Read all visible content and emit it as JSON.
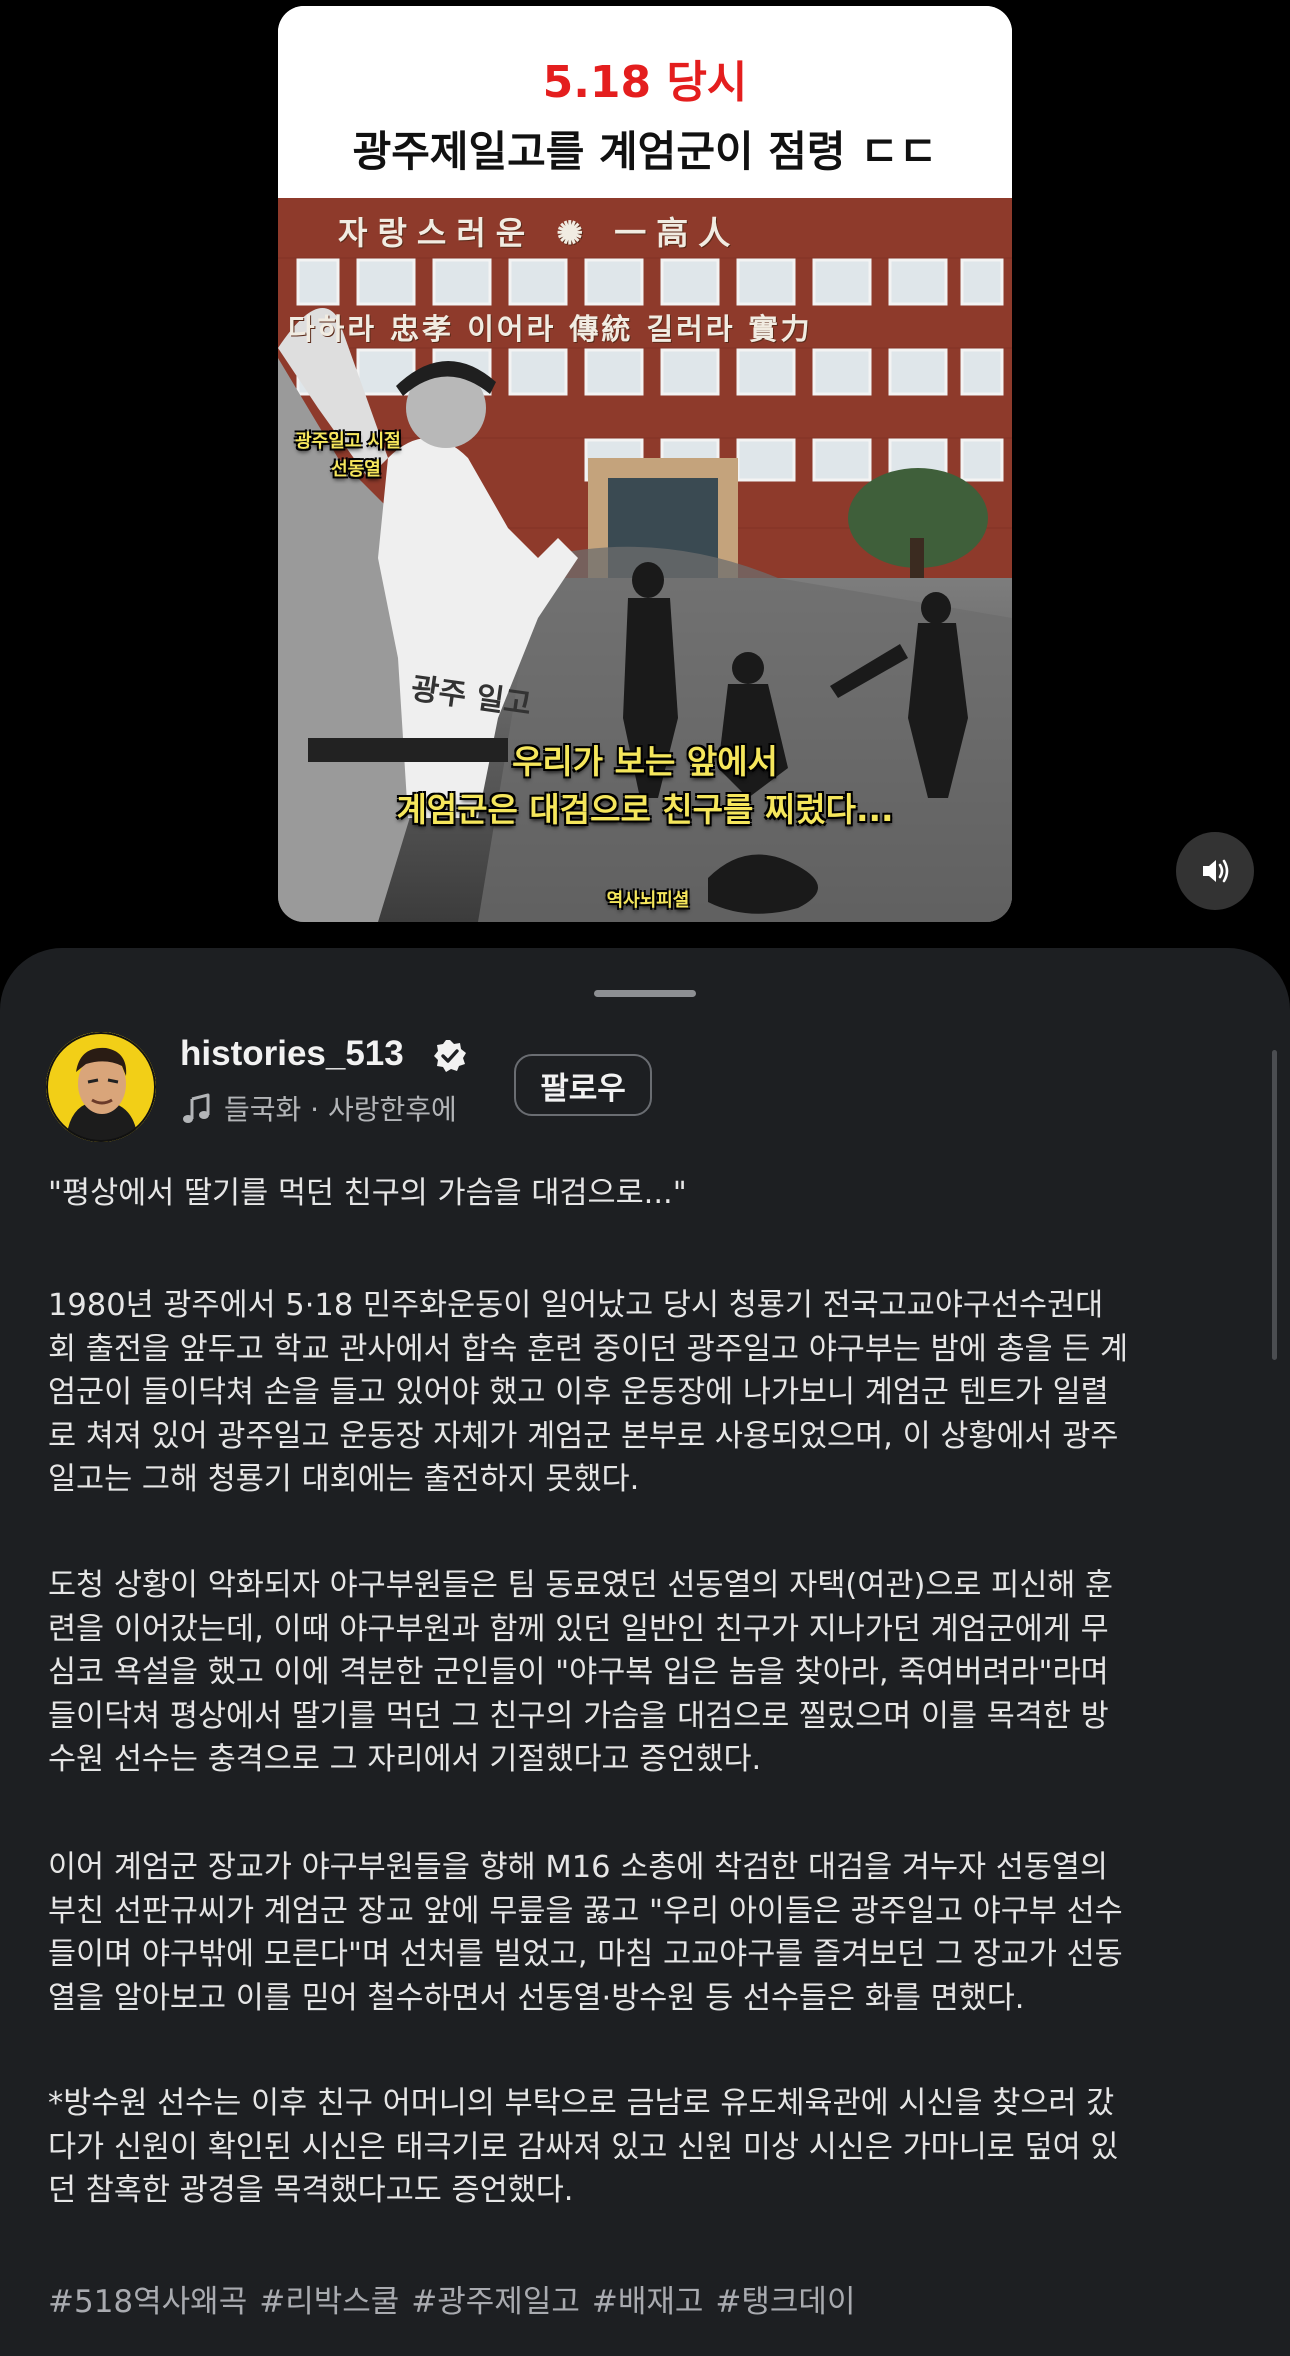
{
  "video": {
    "title_line1": "5.18 당시",
    "title_line2": "광주제일고를 계엄군이 점령 ㄷㄷ",
    "sign_top": "자랑스러운 ✺ 一高人",
    "sign_middle": "다하라 忠孝  이어라 傳統  길러라 實力",
    "photo_label_line1": "광주일고 시절",
    "photo_label_line2": "선동열",
    "caption_line1": "우리가 보는 앞에서",
    "caption_line2": "계엄군은 대검으로 친구를 찌렀다...",
    "watermark": "역사뇌피셜",
    "sound_icon": "speaker-icon"
  },
  "profile": {
    "username": "histories_513",
    "verified_icon": "verified-badge-icon",
    "music_icon": "music-note-icon",
    "music": "들국화 · 사랑한후에",
    "follow_label": "팔로우"
  },
  "description": {
    "quote": "\"평상에서 딸기를 먹던 친구의 가슴을 대검으로...\"",
    "paragraph1": "1980년 광주에서 5·18 민주화운동이 일어났고 당시 청룡기 전국고교야구선수권대\n회 출전을 앞두고 학교 관사에서 합숙 훈련 중이던 광주일고 야구부는 밤에 총을 든 계\n엄군이 들이닥쳐 손을 들고 있어야 했고 이후 운동장에 나가보니 계엄군 텐트가 일렬\n로 쳐져 있어 광주일고 운동장 자체가 계엄군 본부로 사용되었으며, 이 상황에서 광주\n일고는 그해 청룡기 대회에는 출전하지 못했다.",
    "paragraph2": "도청 상황이 악화되자 야구부원들은 팀 동료였던 선동열의 자택(여관)으로 피신해 훈\n련을 이어갔는데, 이때 야구부원과 함께 있던 일반인 친구가 지나가던 계엄군에게 무\n심코 욕설을 했고 이에 격분한 군인들이 \"야구복 입은 놈을 찾아라, 죽여버려라\"라며\n들이닥쳐 평상에서 딸기를 먹던 그 친구의 가슴을 대검으로 찔렀으며 이를 목격한 방\n수원 선수는 충격으로 그 자리에서 기절했다고 증언했다.",
    "paragraph3": "이어 계엄군 장교가 야구부원들을 향해 M16 소총에 착검한 대검을 겨누자 선동열의\n부친 선판규씨가 계엄군 장교 앞에 무릎을 꿇고 \"우리 아이들은 광주일고 야구부 선수\n들이며 야구밖에 모른다\"며 선처를 빌었고, 마침 고교야구를 즐겨보던 그 장교가 선동\n열을 알아보고 이를 믿어 철수하면서 선동열·방수원 등 선수들은 화를 면했다.",
    "paragraph4": "*방수원 선수는 이후 친구 어머니의 부탁으로 금남로 유도체육관에 시신을 찾으러 갔\n다가 신원이 확인된 시신은 태극기로 감싸져 있고 신원 미상 시신은 가마니로 덮여 있\n던 참혹한 광경을 목격했다고도 증언했다.",
    "hashtags": [
      "#518역사왜곡",
      "#리박스쿨",
      "#광주제일고",
      "#배재고",
      "#탱크데이"
    ]
  }
}
